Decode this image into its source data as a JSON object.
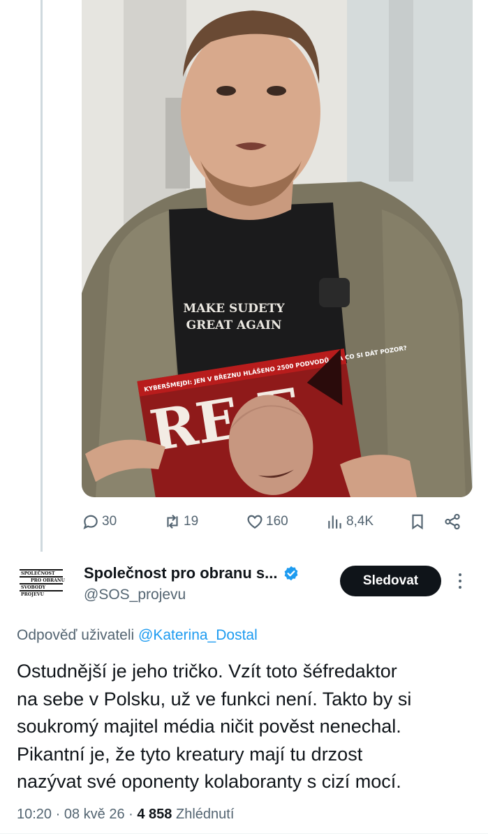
{
  "media": {
    "shirt_line1": "MAKE SUDETY",
    "shirt_line2": "GREAT AGAIN",
    "magazine_banner": "KYBERŠMEJDI: JEN V BŘEZNU HLÁŠENO 2500 PODVODŮ. NA CO SI DÁT POZOR?",
    "magazine_title": "RE E"
  },
  "actions": {
    "replies": "30",
    "reposts": "19",
    "likes": "160",
    "views": "8,4K"
  },
  "author": {
    "avatar_lines": [
      "SPOLEČNOST",
      "PRO OBRANU",
      "SVOBODY",
      "PROJEVU"
    ],
    "display_name": "Společnost pro obranu s...",
    "handle": "@SOS_projevu",
    "verified_color": "#1d9bf0"
  },
  "follow_label": "Sledovat",
  "reply_context": {
    "prefix": "Odpověď uživateli",
    "user": "@Katerina_Dostal"
  },
  "tweet_lines": [
    "Ostudnější je jeho tričko. Vzít toto šéfredaktor",
    "na sebe v Polsku, už ve funkci není. Takto by si",
    "soukromý majitel média ničit pověst nenechal.",
    "Pikantní je, že tyto kreatury mají tu drzost",
    "nazývat své oponenty kolaboranty s cizí mocí."
  ],
  "meta": {
    "time": "10:20",
    "date": "08 kvě 26",
    "view_count": "4 858",
    "view_label": "Zhlédnutí"
  }
}
